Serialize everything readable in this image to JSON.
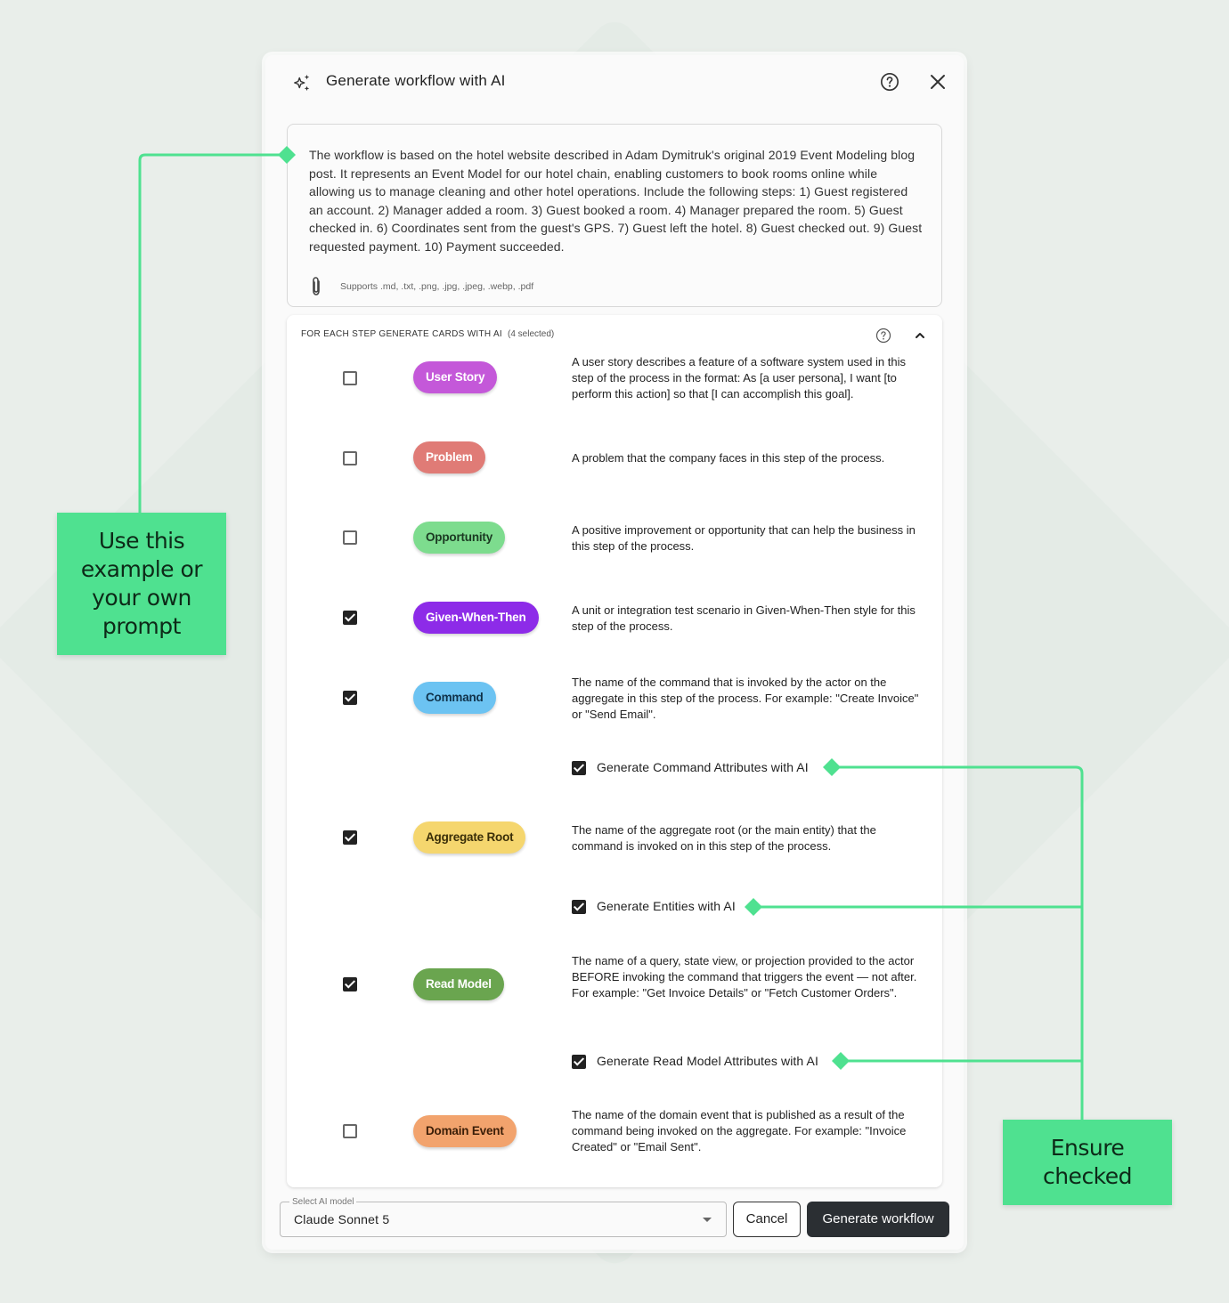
{
  "dialog": {
    "title": "Generate workflow with AI",
    "prompt_text": "The workflow is based on the hotel website described in Adam Dymitruk's original 2019 Event Modeling blog post. It represents an Event Model for our hotel chain, enabling customers to book rooms online while allowing us to manage cleaning and other hotel operations. Include the following steps: 1) Guest registered an account. 2) Manager added a room. 3) Guest booked a room. 4) Manager prepared the room. 5) Guest checked in. 6) Coordinates sent from the guest's GPS. 7) Guest left the hotel. 8) Guest checked out. 9) Guest requested payment. 10) Payment succeeded.",
    "supports_text": "Supports .md, .txt, .png, .jpg, .jpeg, .webp, .pdf"
  },
  "steps": {
    "heading": "FOR EACH STEP GENERATE CARDS WITH AI",
    "selected_count": "(4 selected)",
    "cards": [
      {
        "label": "User Story",
        "checked": false,
        "color": "#c458d9",
        "text_color": "#ffffff",
        "description": "A user story describes a feature of a software system used in this step of the process in the format: As [a user persona], I want [to perform this action] so that [I can accomplish this goal]."
      },
      {
        "label": "Problem",
        "checked": false,
        "color": "#e07b76",
        "text_color": "#ffffff",
        "description": "A problem that the company faces in this step of the process."
      },
      {
        "label": "Opportunity",
        "checked": false,
        "color": "#7ddc8e",
        "text_color": "#1b3a22",
        "description": "A positive improvement or opportunity that can help the business in this step of the process."
      },
      {
        "label": "Given-When-Then",
        "checked": true,
        "color": "#8d2be8",
        "text_color": "#ffffff",
        "description": "A unit or integration test scenario in Given-When-Then style for this step of the process."
      },
      {
        "label": "Command",
        "checked": true,
        "color": "#6cc3f2",
        "text_color": "#10324a",
        "description": "The name of the command that is invoked by the actor on the aggregate in this step of the process. For example: \"Create Invoice\" or \"Send Email\"."
      },
      {
        "label": "Aggregate Root",
        "checked": true,
        "color": "#f5d66e",
        "text_color": "#3a2e08",
        "description": "The name of the aggregate root (or the main entity) that the command is invoked on in this step of the process."
      },
      {
        "label": "Read Model",
        "checked": true,
        "color": "#6aa54f",
        "text_color": "#ffffff",
        "description": "The name of a query, state view, or projection provided to the actor BEFORE invoking the command that triggers the event — not after. For example: \"Get Invoice Details\" or \"Fetch Customer Orders\"."
      },
      {
        "label": "Domain Event",
        "checked": false,
        "color": "#f2a36d",
        "text_color": "#3b1e08",
        "description": "The name of the domain event that is published as a result of the command being invoked on the aggregate. For example: \"Invoice Created\" or \"Email Sent\"."
      }
    ],
    "sub_options": {
      "command_attrs": {
        "label": "Generate Command Attributes with AI",
        "checked": true
      },
      "entities": {
        "label": "Generate Entities with AI",
        "checked": true
      },
      "read_model_attrs": {
        "label": "Generate Read Model Attributes with AI",
        "checked": true
      }
    }
  },
  "footer": {
    "select_label": "Select AI model",
    "model": "Claude Sonnet 5",
    "cancel_label": "Cancel",
    "generate_label": "Generate workflow"
  },
  "annotations": {
    "left": "Use this example or your own prompt",
    "right": "Ensure checked",
    "accent": "#4fe190"
  }
}
